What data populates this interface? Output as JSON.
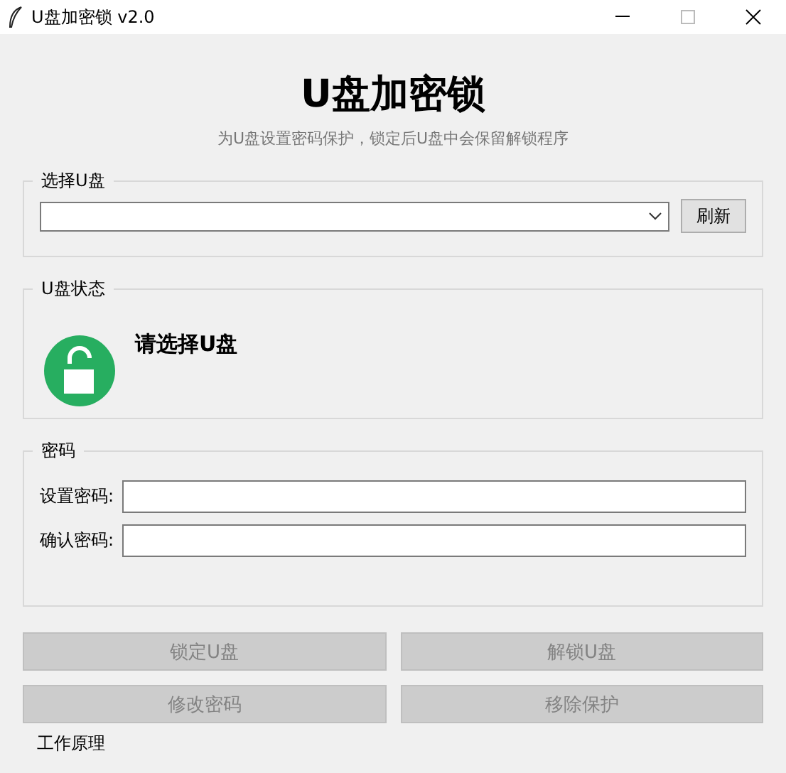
{
  "window": {
    "title": "U盘加密锁 v2.0"
  },
  "header": {
    "title": "U盘加密锁",
    "subtitle": "为U盘设置密码保护，锁定后U盘中会保留解锁程序"
  },
  "drive_group": {
    "label": "选择U盘",
    "refresh_button": "刷新"
  },
  "status_group": {
    "label": "U盘状态",
    "locked": false,
    "message": "请选择U盘"
  },
  "password_group": {
    "label": "密码",
    "fields": [
      {
        "label": "设置密码:"
      },
      {
        "label": "确认密码:"
      }
    ]
  },
  "actions": [
    {
      "label": "锁定U盘",
      "disabled": true
    },
    {
      "label": "解锁U盘",
      "disabled": true
    },
    {
      "label": "修改密码",
      "disabled": true
    },
    {
      "label": "移除保护",
      "disabled": true
    }
  ],
  "info_group": {
    "label": "工作原理"
  }
}
